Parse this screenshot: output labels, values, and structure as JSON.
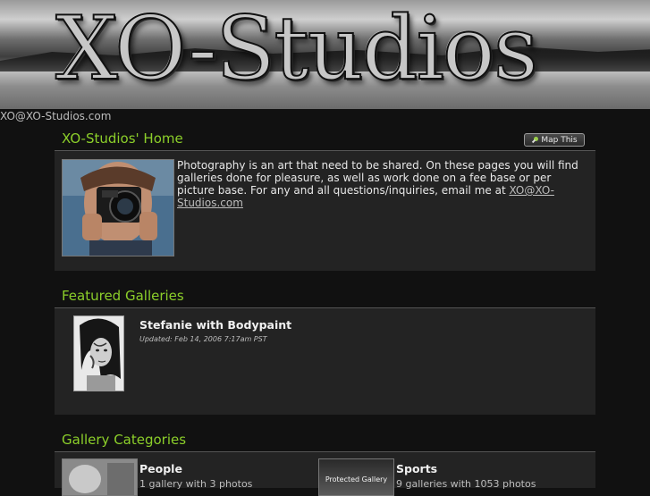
{
  "header": {
    "logo_text": "XO-Studios",
    "email": "XO@XO-Studios.com"
  },
  "home": {
    "title": "XO-Studios' Home",
    "map_button_label": "Map This",
    "intro_text": "Photography is an art that need to be shared. On these pages you will find galleries done for pleasure, as well as work done on a fee base or per picture base. For any and all questions/inquiries, email me at ",
    "intro_email": "XO@XO-Studios.com"
  },
  "featured": {
    "title": "Featured Galleries",
    "galleries": [
      {
        "name": "Stefanie with Bodypaint",
        "updated": "Updated: Feb 14, 2006 7:17am PST"
      }
    ]
  },
  "categories": {
    "title": "Gallery Categories",
    "items": [
      {
        "name": "People",
        "count": "1 gallery with 3 photos"
      },
      {
        "name": "Sports",
        "count": "9 galleries with 1053 photos",
        "thumb_label": "Protected Gallery"
      }
    ]
  },
  "colors": {
    "accent_green": "#8ccf2a",
    "panel_bg": "#232323",
    "page_bg": "#111111"
  }
}
